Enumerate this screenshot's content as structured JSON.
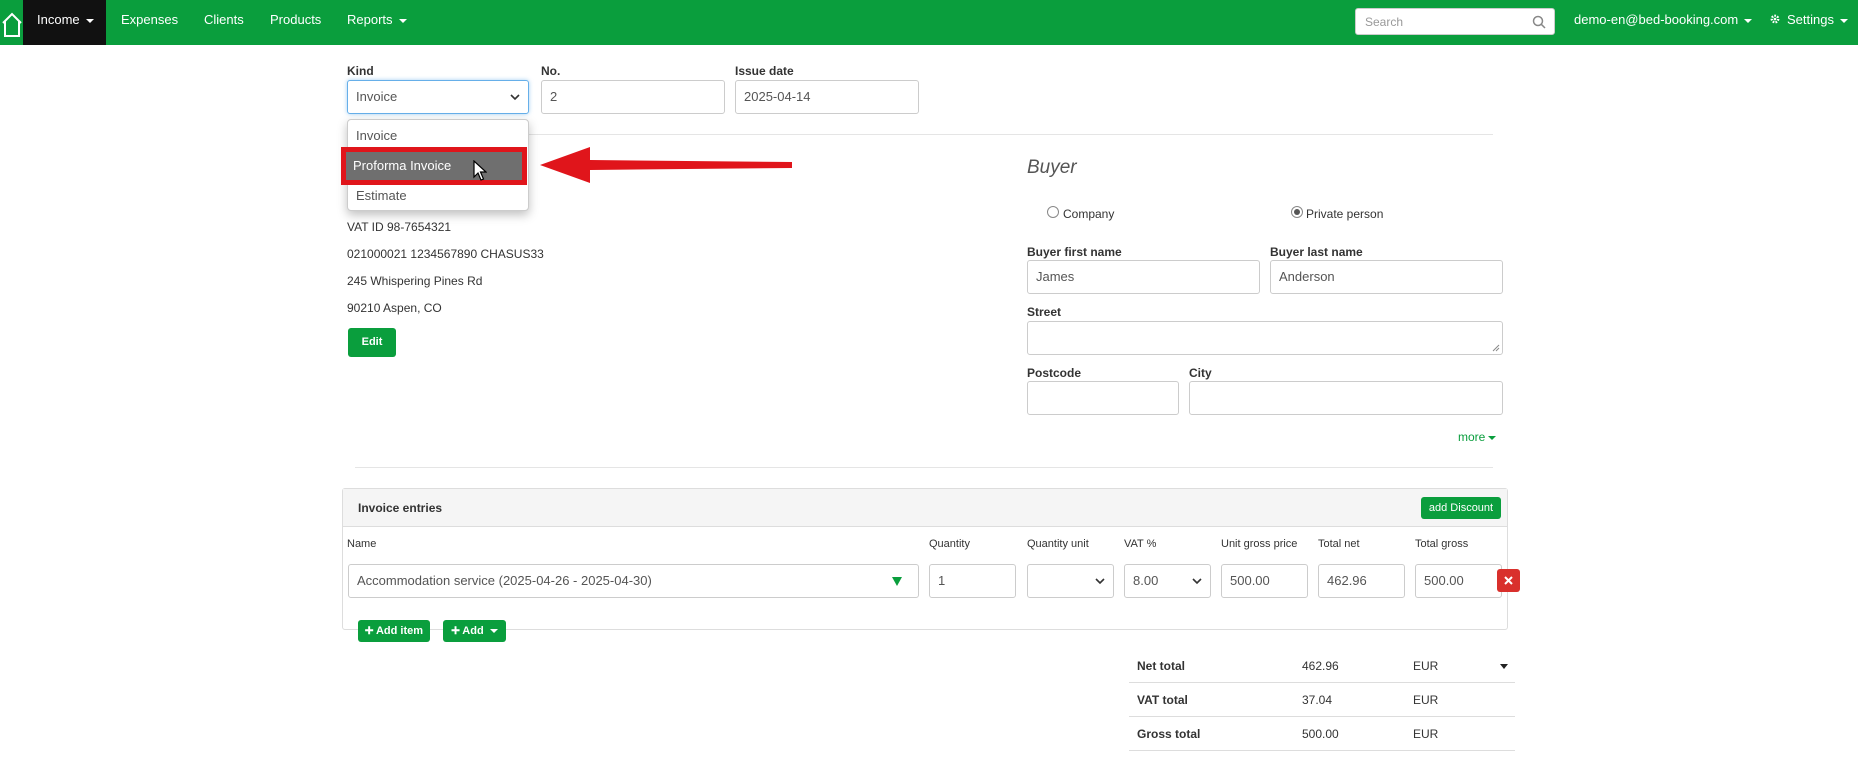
{
  "nav": {
    "income": "Income",
    "expenses": "Expenses",
    "clients": "Clients",
    "products": "Products",
    "reports": "Reports",
    "search_placeholder": "Search",
    "account": "demo-en@bed-booking.com",
    "settings": "Settings",
    "brand_color": "#0a9e3d"
  },
  "doc": {
    "kind_label": "Kind",
    "kind_value": "Invoice",
    "kind_options": [
      "Invoice",
      "Proforma Invoice",
      "Estimate"
    ],
    "highlighted_option": "Proforma Invoice",
    "no_label": "No.",
    "no_value": "2",
    "issue_date_label": "Issue date",
    "issue_date_value": "2025-04-14"
  },
  "seller": {
    "lines": [
      "VAT ID 98-7654321",
      "021000021 1234567890 CHASUS33",
      "245 Whispering Pines Rd",
      "90210 Aspen, CO"
    ],
    "edit_label": "Edit"
  },
  "buyer": {
    "title": "Buyer",
    "type_company": "Company",
    "type_private": "Private person",
    "selected_type": "Private person",
    "first_name_label": "Buyer first name",
    "first_name_value": "James",
    "last_name_label": "Buyer last name",
    "last_name_value": "Anderson",
    "street_label": "Street",
    "street_value": "",
    "postcode_label": "Postcode",
    "postcode_value": "",
    "city_label": "City",
    "city_value": "",
    "more_label": "more"
  },
  "entries": {
    "title": "Invoice entries",
    "add_discount": "add Discount",
    "columns": {
      "name": "Name",
      "quantity": "Quantity",
      "quantity_unit": "Quantity unit",
      "vat": "VAT %",
      "unit_gross": "Unit gross price",
      "total_net": "Total net",
      "total_gross": "Total gross"
    },
    "row": {
      "name": "Accommodation service (2025-04-26 - 2025-04-30)",
      "quantity": "1",
      "quantity_unit": "",
      "vat": "8.00",
      "unit_gross": "500.00",
      "total_net": "462.96",
      "total_gross": "500.00"
    },
    "add_item": "Add item",
    "add": "Add"
  },
  "totals": [
    {
      "label": "Net total",
      "value": "462.96",
      "currency": "EUR"
    },
    {
      "label": "VAT total",
      "value": "37.04",
      "currency": "EUR"
    },
    {
      "label": "Gross total",
      "value": "500.00",
      "currency": "EUR"
    }
  ],
  "annotation": {
    "highlight_color": "#e0151b"
  }
}
